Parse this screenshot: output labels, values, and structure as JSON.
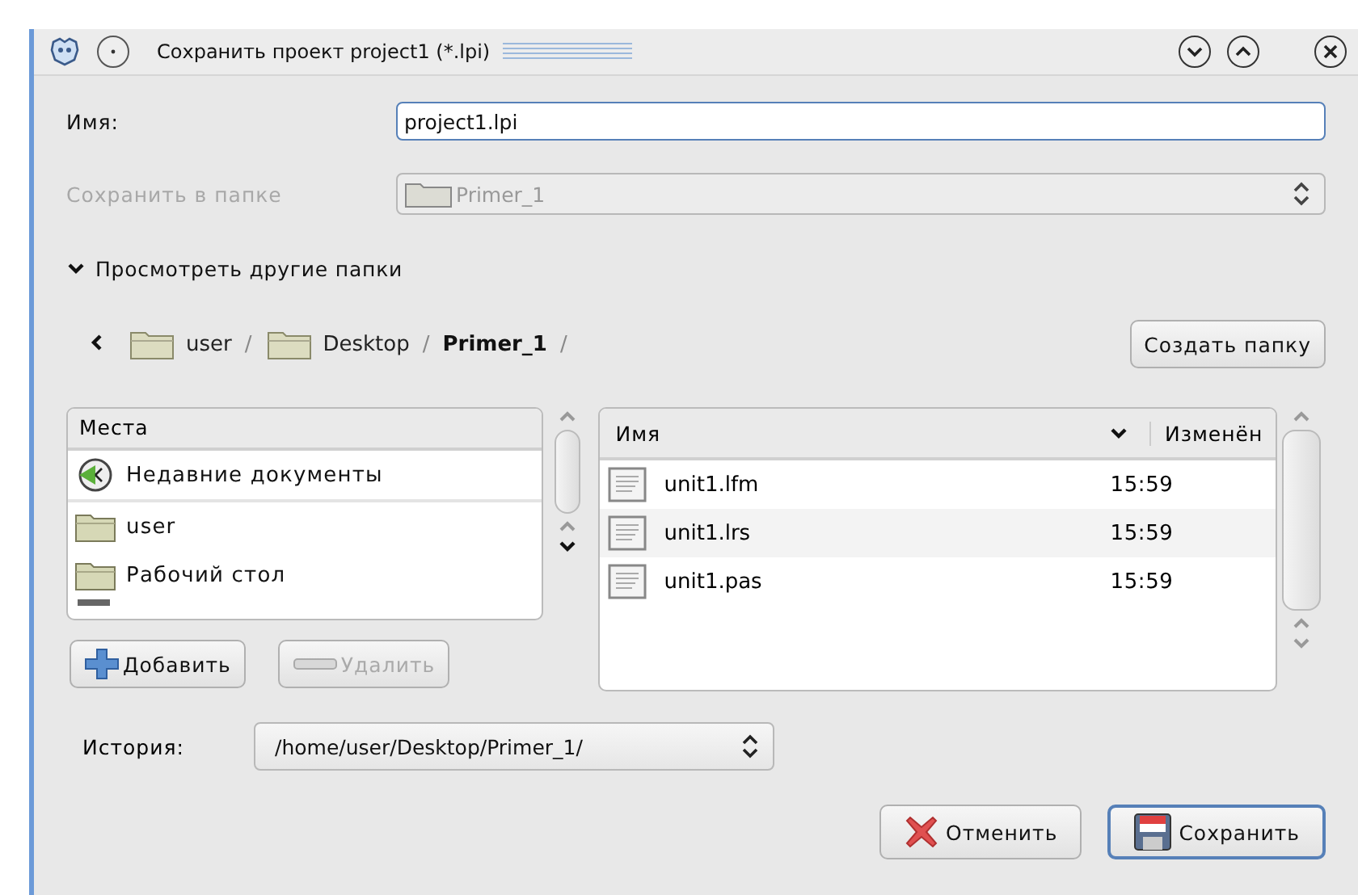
{
  "window": {
    "title": "Сохранить проект project1 (*.lpi)"
  },
  "name_field": {
    "label": "Имя:",
    "value": "project1.lpi"
  },
  "save_in": {
    "label": "Сохранить в папке",
    "value": "Primer_1",
    "disabled": true
  },
  "browse_toggle": {
    "label": "Просмотреть другие папки",
    "expanded": true
  },
  "path_bar": [
    {
      "label": "user",
      "current": false,
      "separator": "/"
    },
    {
      "label": "Desktop",
      "current": false,
      "separator": "/"
    },
    {
      "label": "Primer_1",
      "current": true,
      "separator": "/"
    }
  ],
  "create_folder_button": "Создать папку",
  "places": {
    "header": "Места",
    "items": [
      {
        "label": "Недавние документы",
        "kind": "recent"
      },
      {
        "label": "user",
        "kind": "folder"
      },
      {
        "label": "Рабочий стол",
        "kind": "folder"
      }
    ]
  },
  "add_button": {
    "label": "Добавить",
    "disabled": false
  },
  "remove_button": {
    "label": "Удалить",
    "disabled": true
  },
  "files": {
    "columns": [
      "Имя",
      "Изменён"
    ],
    "rows": [
      {
        "name": "unit1.lfm",
        "modified": "15:59"
      },
      {
        "name": "unit1.lrs",
        "modified": "15:59"
      },
      {
        "name": "unit1.pas",
        "modified": "15:59"
      }
    ]
  },
  "history": {
    "label": "История:",
    "value": "/home/user/Desktop/Primer_1/"
  },
  "buttons": [
    {
      "label": "Отменить",
      "kind": "cancel",
      "default": false
    },
    {
      "label": "Сохранить",
      "kind": "save",
      "default": true
    }
  ]
}
